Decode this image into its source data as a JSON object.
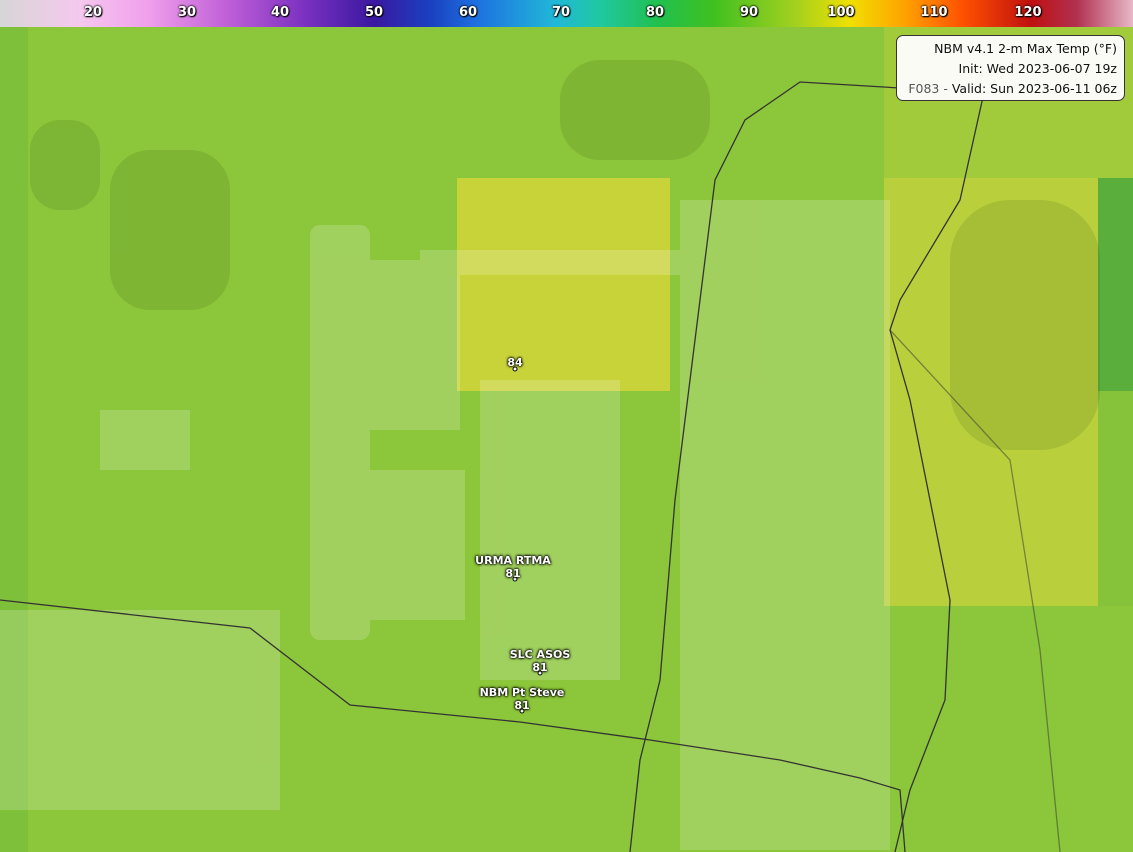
{
  "colorbar": {
    "ticks": [
      "20",
      "30",
      "40",
      "50",
      "60",
      "70",
      "80",
      "90",
      "100",
      "110",
      "120"
    ]
  },
  "info": {
    "title": "NBM v4.1 2-m Max Temp (°F)",
    "init": "Init: Wed 2023-06-07 19z",
    "forecast_hour": "F083",
    "separator": " - ",
    "valid": "Valid: Sun 2023-06-11 06z"
  },
  "stations": [
    {
      "name": "",
      "value": "84"
    },
    {
      "name": "URMA RTMA",
      "value": "81"
    },
    {
      "name": "SLC ASOS",
      "value": "81"
    },
    {
      "name": "NBM Pt Steve",
      "value": "81"
    }
  ],
  "colors": {
    "field_81": "#8cc63a",
    "field_84": "#c9d43a",
    "field_83": "#b8d03c",
    "field_78": "#4faa3c",
    "road": "#333333"
  }
}
